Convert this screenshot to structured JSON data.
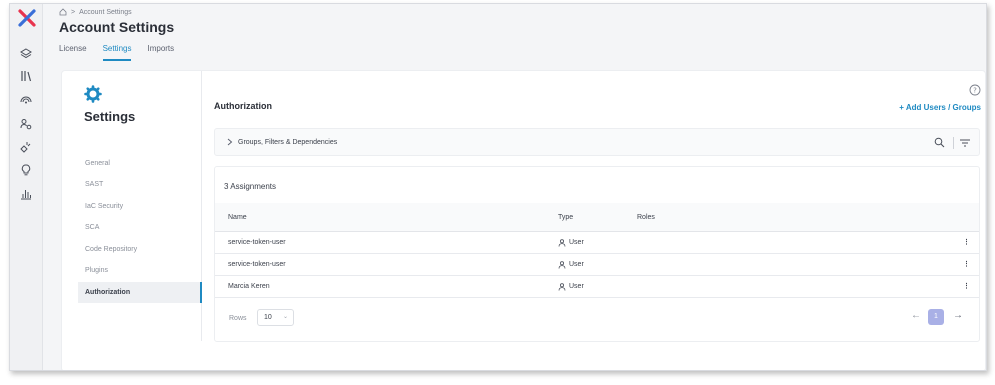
{
  "colors": {
    "accent": "#1f8ac2",
    "logo_red": "#e8344e",
    "logo_blue": "#3a6fd8",
    "page_active": "#a9b0e6"
  },
  "rail": {
    "icons": [
      "layers-icon",
      "library-icon",
      "signal-icon",
      "users-gear-icon",
      "plug-icon",
      "lightbulb-icon",
      "bar-chart-icon"
    ]
  },
  "breadcrumb": {
    "home_icon": "home-icon",
    "separator": ">",
    "current": "Account Settings"
  },
  "page": {
    "title": "Account Settings"
  },
  "tabs": [
    {
      "label": "License",
      "active": false
    },
    {
      "label": "Settings",
      "active": true
    },
    {
      "label": "Imports",
      "active": false
    }
  ],
  "settings_nav": {
    "title": "Settings",
    "items": [
      {
        "label": "General",
        "active": false
      },
      {
        "label": "SAST",
        "active": false
      },
      {
        "label": "IaC Security",
        "active": false
      },
      {
        "label": "SCA",
        "active": false
      },
      {
        "label": "Code Repository",
        "active": false
      },
      {
        "label": "Plugins",
        "active": false
      },
      {
        "label": "Authorization",
        "active": true
      }
    ]
  },
  "authorization": {
    "title": "Authorization",
    "add_label": "+ Add Users / Groups",
    "filter_label": "Groups, Filters & Dependencies",
    "assignments_label": "3 Assignments",
    "columns": {
      "name": "Name",
      "type": "Type",
      "roles": "Roles"
    },
    "rows": [
      {
        "name": "service-token-user",
        "type": "User",
        "roles": "",
        "menu": "⋮"
      },
      {
        "name": "service-token-user",
        "type": "User",
        "roles": "",
        "menu": "⋮"
      },
      {
        "name": "Marcia Keren",
        "type": "User",
        "roles": "",
        "menu": "⋮"
      }
    ],
    "rows_label": "Rows",
    "rows_value": "10",
    "current_page": "1",
    "prev_arrow": "←",
    "next_arrow": "→"
  }
}
